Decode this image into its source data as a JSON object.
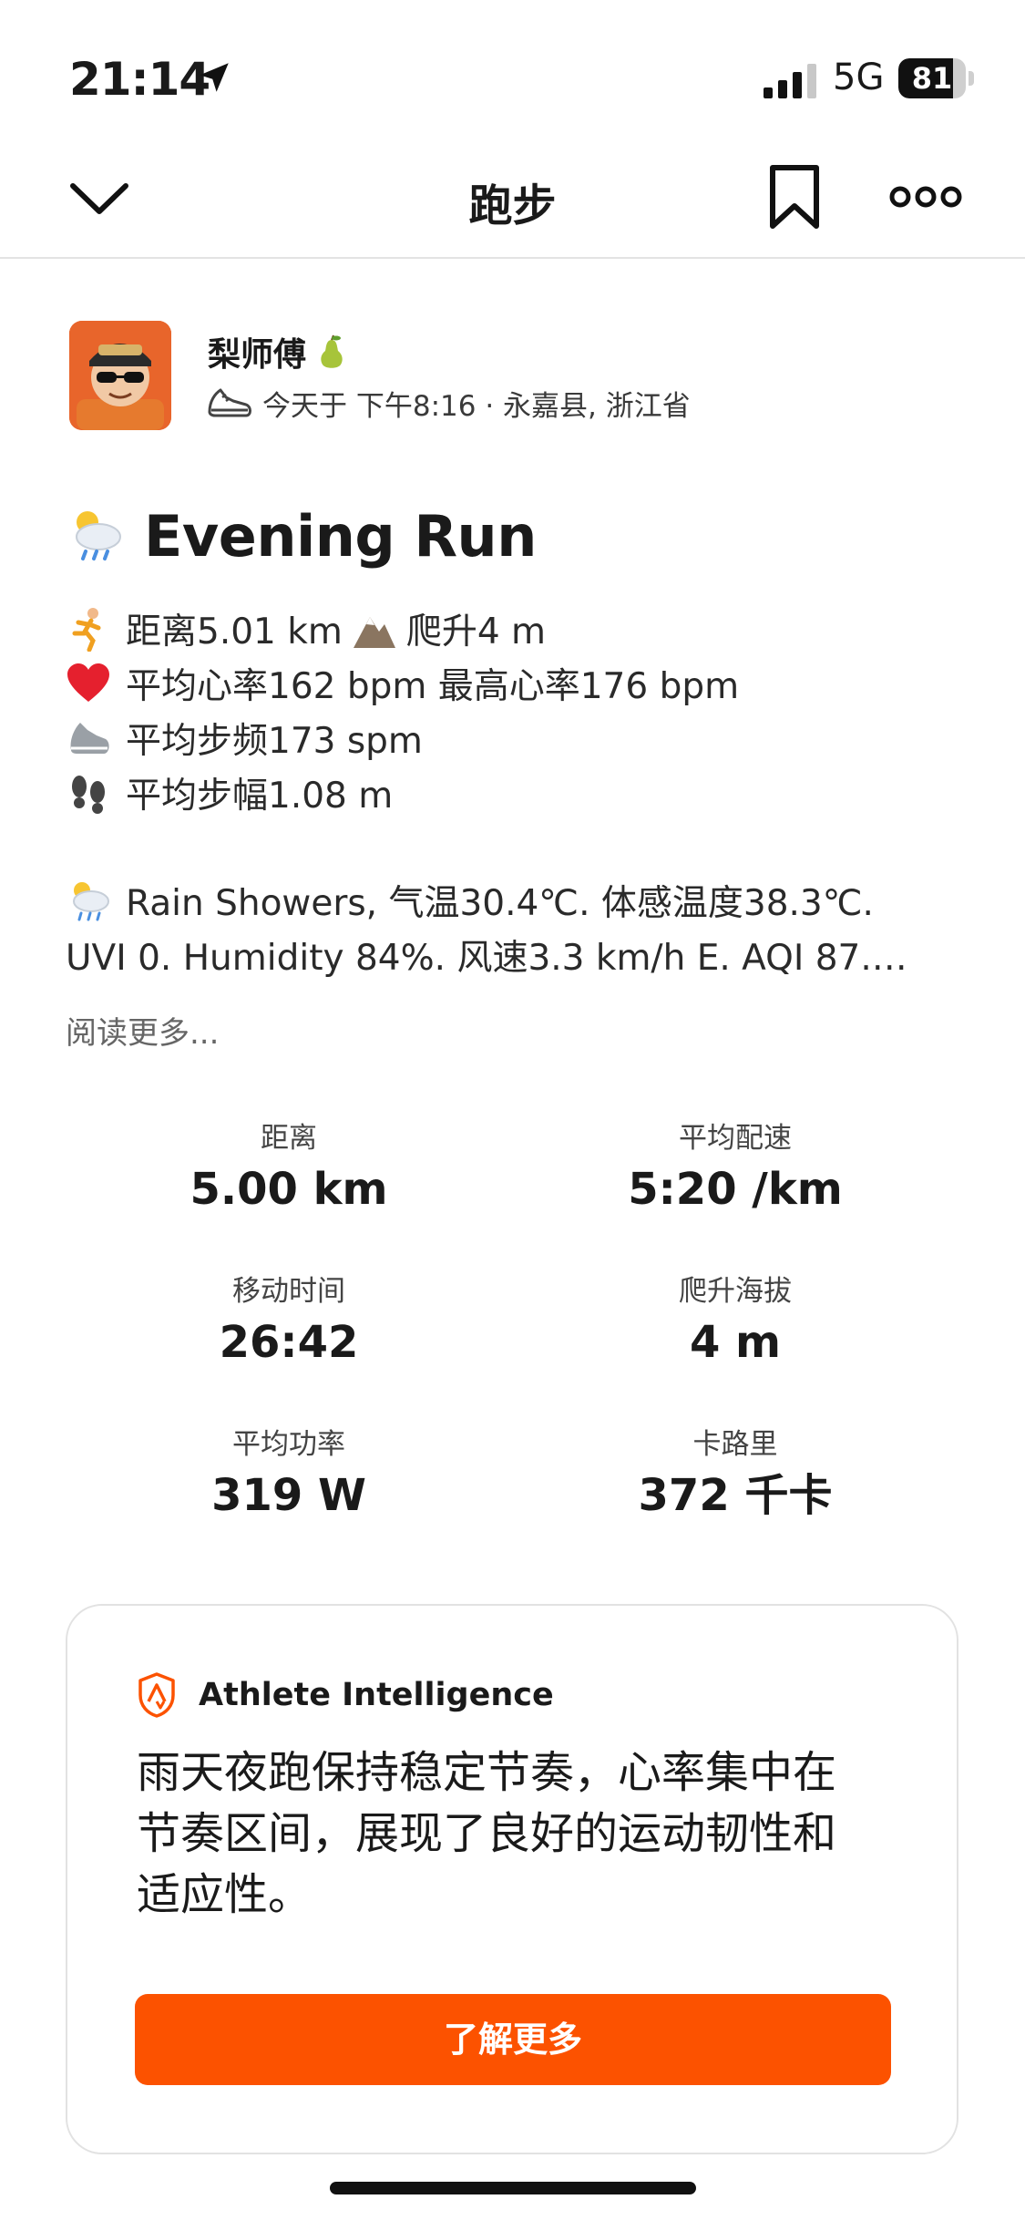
{
  "status_bar": {
    "time": "21:14",
    "network": "5G",
    "battery": "81",
    "battery_level_pct": 81
  },
  "nav": {
    "title": "跑步",
    "icons": [
      "chevron-down-icon",
      "bookmark-icon",
      "more-icon"
    ]
  },
  "athlete": {
    "name": "梨师傅",
    "meta": "今天于 下午8:16 · 永嘉县, 浙江省"
  },
  "activity": {
    "title": "Evening Run",
    "description_lines": [
      {
        "prefix": "距离5.01 km",
        "suffix": "爬升4 m"
      },
      {
        "text": "平均心率162 bpm 最高心率176 bpm"
      },
      {
        "text": "平均步频173 spm"
      },
      {
        "text": "平均步幅1.08 m"
      }
    ],
    "weather_line1": "Rain Showers, 气温30.4℃. 体感温度38.3℃.",
    "weather_line2": "UVI 0. Humidity 84%. 风速3.3 km/h E. AQI 87.…",
    "read_more": "阅读更多..."
  },
  "stats": [
    {
      "label": "距离",
      "value": "5.00 km"
    },
    {
      "label": "平均配速",
      "value": "5:20 /km"
    },
    {
      "label": "移动时间",
      "value": "26:42"
    },
    {
      "label": "爬升海拔",
      "value": "4 m"
    },
    {
      "label": "平均功率",
      "value": "319 W"
    },
    {
      "label": "卡路里",
      "value": "372 千卡"
    }
  ],
  "ai_card": {
    "title": "Athlete Intelligence",
    "body_lines": [
      "雨天夜跑保持稳定节奏，心率集中在",
      "节奏区间，展现了良好的运动韧性和",
      "适应性。"
    ],
    "button": "了解更多"
  },
  "colors": {
    "accent": "#fc5200",
    "text": "#1a1a1a",
    "muted": "#666666"
  }
}
